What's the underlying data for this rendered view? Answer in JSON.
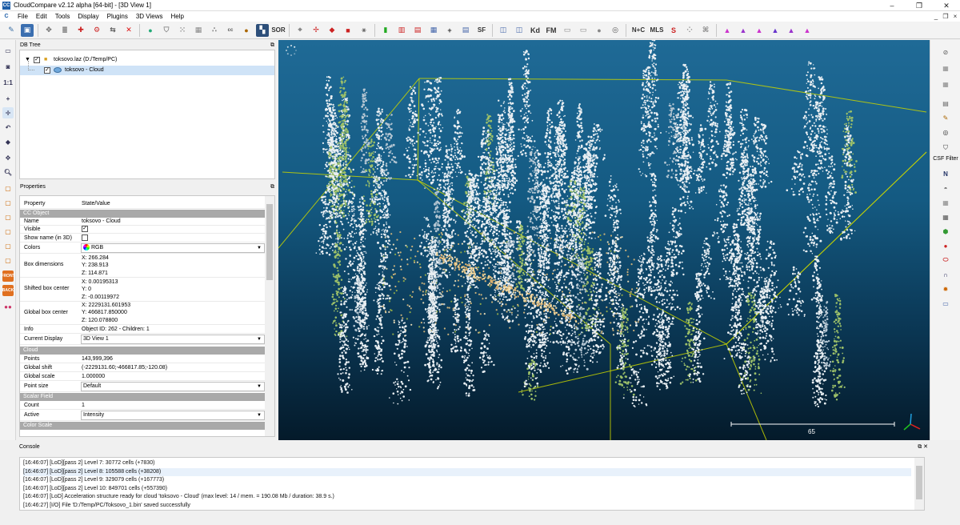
{
  "window": {
    "title": "CloudCompare v2.12 alpha [64-bit] - [3D View 1]",
    "app_icon": "CC",
    "buttons": [
      "–",
      "❐",
      "✕"
    ]
  },
  "menu": {
    "items": [
      "File",
      "Edit",
      "Tools",
      "Display",
      "Plugins",
      "3D Views",
      "Help"
    ],
    "mdi_controls": [
      "_",
      "❐",
      "×"
    ]
  },
  "toolbar": {
    "labels": {
      "sor": "SOR",
      "sf": "SF",
      "kd": "Kd",
      "fm": "FM",
      "nc": "N+C",
      "mls": "MLS",
      "s": "S"
    }
  },
  "dbtree": {
    "header": "DB Tree",
    "items": [
      {
        "label": "toksovo.laz (D:/Temp/PC)"
      },
      {
        "label": "toksovo - Cloud"
      }
    ]
  },
  "properties": {
    "header": "Properties",
    "col_property": "Property",
    "col_value": "State/Value",
    "sec_ccobject": "CC Object",
    "name_k": "Name",
    "name_v": "toksovo - Cloud",
    "visible_k": "Visible",
    "showname_k": "Show name (in 3D)",
    "colors_k": "Colors",
    "colors_v": "RGB",
    "boxdim_k": "Box dimensions",
    "boxdim_x": "X: 266.284",
    "boxdim_y": "Y: 238.913",
    "boxdim_z": "Z: 114.871",
    "shifted_k": "Shifted box center",
    "shifted_x": "X: 0.00195313",
    "shifted_y": "Y: 0",
    "shifted_z": "Z: -0.00119972",
    "global_k": "Global box center",
    "global_x": "X: 2229131.601953",
    "global_y": "Y: 466817.850000",
    "global_z": "Z: 120.078800",
    "info_k": "Info",
    "info_v": "Object ID: 262 - Children: 1",
    "curdisp_k": "Current Display",
    "curdisp_v": "3D View 1",
    "sec_cloud": "Cloud",
    "points_k": "Points",
    "points_v": "143,999,396",
    "gshift_k": "Global shift",
    "gshift_v": "(-2229131.60;-466817.85;-120.08)",
    "gscale_k": "Global scale",
    "gscale_v": "1.000000",
    "psize_k": "Point size",
    "psize_v": "Default",
    "sec_sf": "Scalar Field",
    "count_k": "Count",
    "count_v": "1",
    "active_k": "Active",
    "active_v": "Intensity",
    "sec_colorscale": "Color Scale"
  },
  "view3d": {
    "scale_label": "65"
  },
  "right_toolbar": {
    "csf_label": "CSF Filter",
    "north_label": "N"
  },
  "console": {
    "header": "Console",
    "lines": [
      "[16:46:07] [LoD][pass 2] Level 7: 30772 cells (+7830)",
      "[16:46:07] [LoD][pass 2] Level 8: 105588 cells (+38208)",
      "[16:46:07] [LoD][pass 2] Level 9: 329079 cells (+167773)",
      "[16:46:07] [LoD][pass 2] Level 10: 849701 cells (+557390)",
      "[16:46:07] [LoD] Acceleration structure ready for cloud 'toksovo - Cloud' (max level: 14 / mem. = 190.08 Mb / duration: 38.9 s.)",
      "[16:46:27] [I/O] File 'D:/Temp/PC/Toksovo_1.bin' saved successfully"
    ]
  }
}
